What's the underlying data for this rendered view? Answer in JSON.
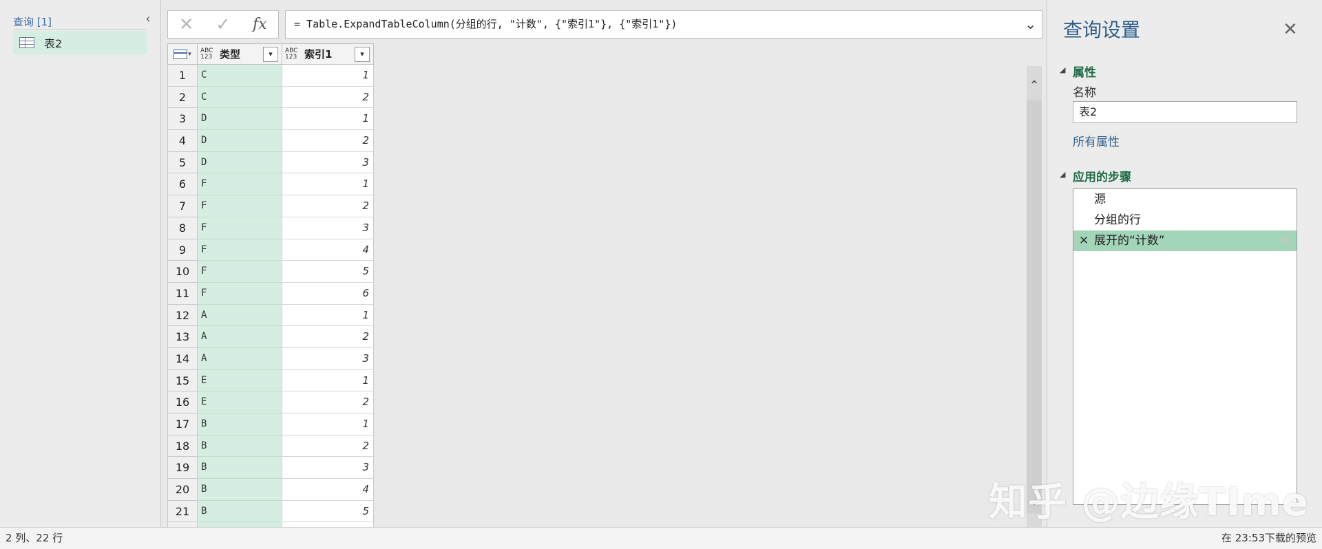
{
  "queries_pane": {
    "title": "查询 [1]",
    "collapse_icon": "chevron-left-icon",
    "items": [
      {
        "label": "表2",
        "icon": "table-icon"
      }
    ]
  },
  "formula_bar": {
    "cancel_glyph": "✕",
    "commit_glyph": "✓",
    "fx_glyph": "fx",
    "formula": "= Table.ExpandTableColumn(分组的行, \"计数\", {\"索引1\"}, {\"索引1\"})",
    "expand_glyph": "⌄"
  },
  "grid": {
    "columns": [
      {
        "type_icon": "ABC 123",
        "name": "类型",
        "filter_glyph": "▾"
      },
      {
        "type_icon": "ABC 123",
        "name": "索引1",
        "filter_glyph": "▾"
      }
    ],
    "rows": [
      {
        "n": "1",
        "type": "C",
        "idx": "1"
      },
      {
        "n": "2",
        "type": "C",
        "idx": "2"
      },
      {
        "n": "3",
        "type": "D",
        "idx": "1"
      },
      {
        "n": "4",
        "type": "D",
        "idx": "2"
      },
      {
        "n": "5",
        "type": "D",
        "idx": "3"
      },
      {
        "n": "6",
        "type": "F",
        "idx": "1"
      },
      {
        "n": "7",
        "type": "F",
        "idx": "2"
      },
      {
        "n": "8",
        "type": "F",
        "idx": "3"
      },
      {
        "n": "9",
        "type": "F",
        "idx": "4"
      },
      {
        "n": "10",
        "type": "F",
        "idx": "5"
      },
      {
        "n": "11",
        "type": "F",
        "idx": "6"
      },
      {
        "n": "12",
        "type": "A",
        "idx": "1"
      },
      {
        "n": "13",
        "type": "A",
        "idx": "2"
      },
      {
        "n": "14",
        "type": "A",
        "idx": "3"
      },
      {
        "n": "15",
        "type": "E",
        "idx": "1"
      },
      {
        "n": "16",
        "type": "E",
        "idx": "2"
      },
      {
        "n": "17",
        "type": "B",
        "idx": "1"
      },
      {
        "n": "18",
        "type": "B",
        "idx": "2"
      },
      {
        "n": "19",
        "type": "B",
        "idx": "3"
      },
      {
        "n": "20",
        "type": "B",
        "idx": "4"
      },
      {
        "n": "21",
        "type": "B",
        "idx": "5"
      }
    ]
  },
  "scrollbar": {
    "up_glyph": "⌃",
    "down_glyph": "⌄"
  },
  "settings": {
    "title": "查询设置",
    "close_glyph": "✕",
    "properties": {
      "title": "属性",
      "name_label": "名称",
      "name_value": "表2",
      "all_properties": "所有属性"
    },
    "steps": {
      "title": "应用的步骤",
      "items": [
        {
          "label": "源"
        },
        {
          "label": "分组的行"
        },
        {
          "label": "展开的“计数”",
          "active": true
        }
      ],
      "delete_glyph": "✕",
      "gear_glyph": "⚙"
    }
  },
  "status_bar": {
    "left": "2 列、22 行",
    "right": "在 23:53下载的预览"
  },
  "watermark": "知乎 @边缘TIme",
  "colors": {
    "selected_bg": "#d5eee1",
    "active_step_bg": "#a3d6b9",
    "section_title": "#1e6b46",
    "link": "#2d5f8a"
  }
}
